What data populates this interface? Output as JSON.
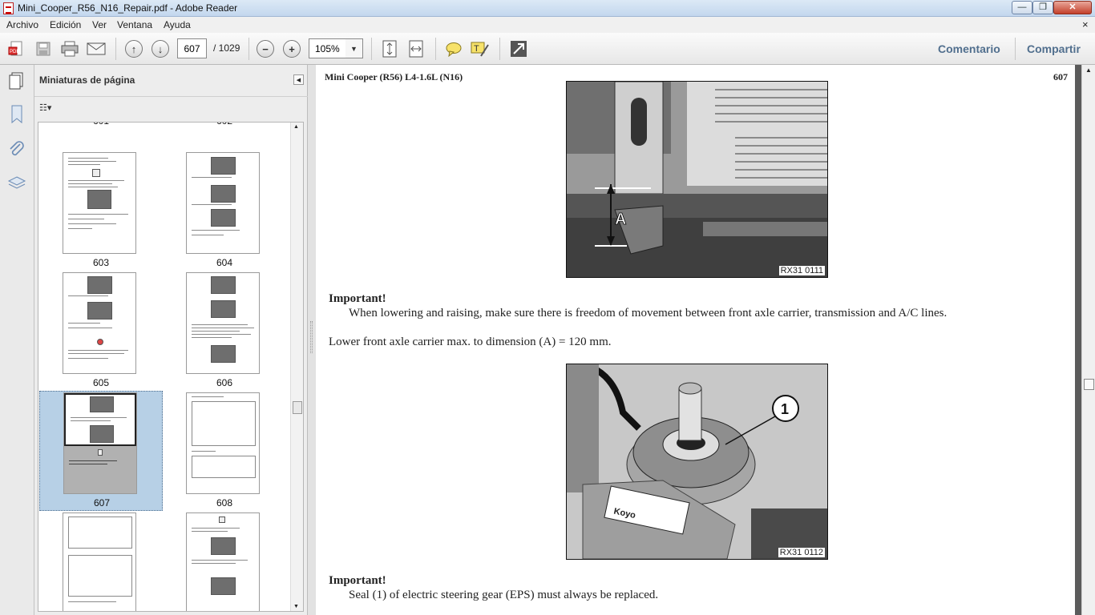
{
  "window": {
    "title": "Mini_Cooper_R56_N16_Repair.pdf - Adobe Reader",
    "min_glyph": "—",
    "max_glyph": "❐",
    "close_glyph": "✕"
  },
  "menu": {
    "items": [
      "Archivo",
      "Edición",
      "Ver",
      "Ventana",
      "Ayuda"
    ],
    "close_glyph": "×"
  },
  "toolbar": {
    "page_value": "607",
    "page_total": "/ 1029",
    "zoom_value": "105%",
    "comentario": "Comentario",
    "compartir": "Compartir"
  },
  "panel": {
    "title": "Miniaturas de página",
    "thumbnails": [
      {
        "label": "601"
      },
      {
        "label": "602"
      },
      {
        "label": "603"
      },
      {
        "label": "604"
      },
      {
        "label": "605"
      },
      {
        "label": "606"
      },
      {
        "label": "607",
        "selected": true
      },
      {
        "label": "608"
      },
      {
        "label": ""
      },
      {
        "label": ""
      }
    ]
  },
  "document": {
    "header_title": "Mini Cooper (R56) L4-1.6L (N16)",
    "page_number": "607",
    "figure1": {
      "caption": "RX31 0111",
      "label": "A"
    },
    "important1_title": "Important!",
    "important1_text": "When lowering and raising, make sure there is freedom of movement between front axle carrier, transmission and A/C lines.",
    "instruction": "Lower front axle carrier max. to dimension (A) = 120 mm.",
    "figure2": {
      "caption": "RX31 0112",
      "callout": "1",
      "brand": "Koyo"
    },
    "important2_title": "Important!",
    "important2_text": "Seal (1) of electric steering gear (EPS) must always be replaced."
  }
}
